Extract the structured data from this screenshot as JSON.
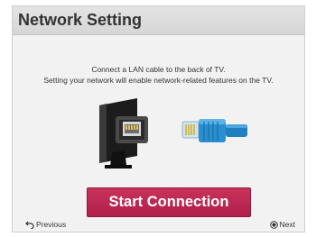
{
  "header": {
    "title": "Network Setting"
  },
  "instructions": {
    "line1": "Connect a LAN cable to the back of TV.",
    "line2": "Setting your network will enable network-related features on the TV."
  },
  "illustration": {
    "tv_icon": "tv-back-lan-port-icon",
    "cable_icon": "lan-cable-icon"
  },
  "actions": {
    "start_label": "Start Connection"
  },
  "footer": {
    "previous_label": "Previous",
    "previous_icon": "back-arrow-icon",
    "next_label": "Next",
    "next_icon": "ok-button-icon"
  },
  "colors": {
    "accent": "#b8264f",
    "cable_blue": "#2a8fd0"
  }
}
